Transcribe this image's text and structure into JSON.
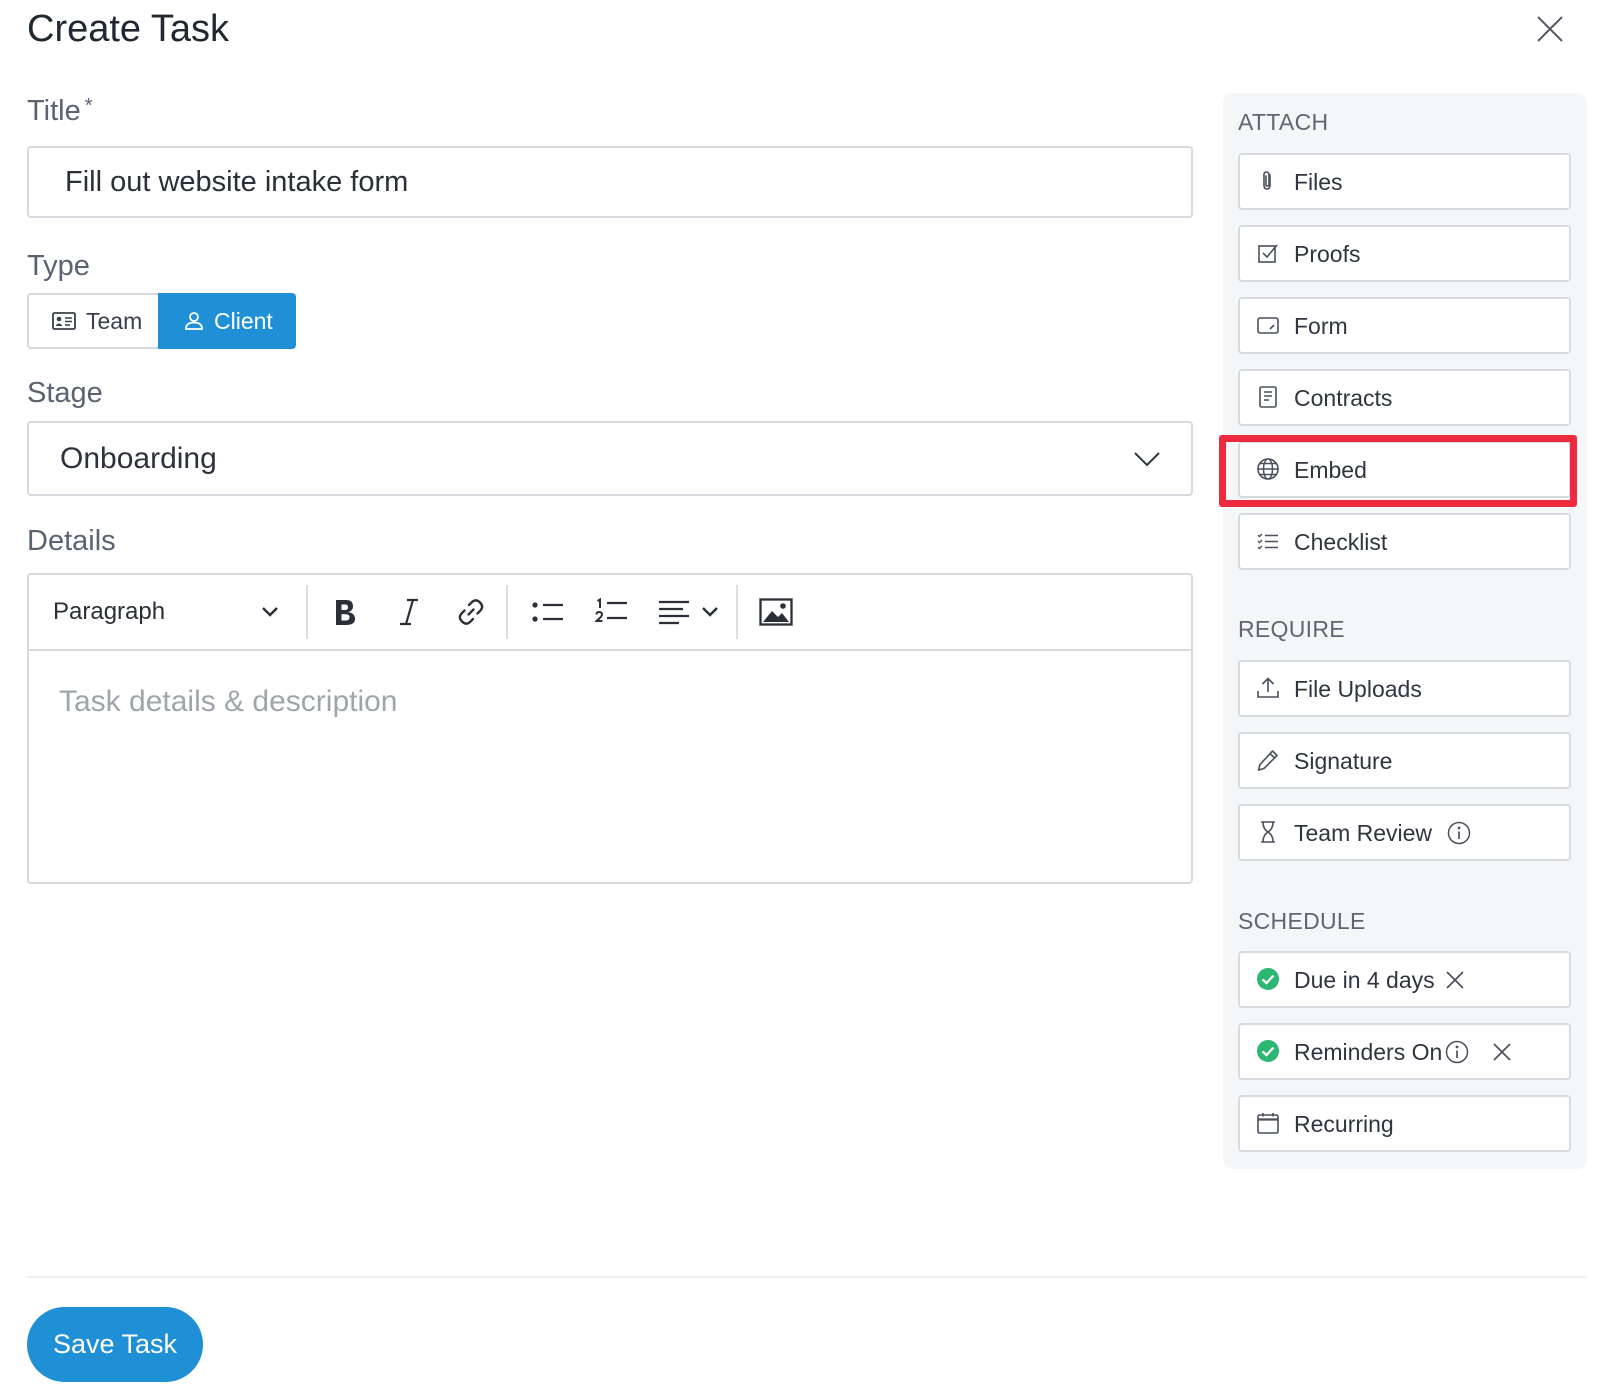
{
  "modal": {
    "title": "Create Task"
  },
  "title_field": {
    "label": "Title",
    "required_mark": "*",
    "value": "Fill out website intake form"
  },
  "type_field": {
    "label": "Type",
    "options": [
      {
        "label": "Team"
      },
      {
        "label": "Client"
      }
    ],
    "selected": "Client"
  },
  "stage_field": {
    "label": "Stage",
    "value": "Onboarding"
  },
  "details_field": {
    "label": "Details",
    "toolbar": {
      "format_select": "Paragraph"
    },
    "placeholder": "Task details & description"
  },
  "sidebar": {
    "attach": {
      "title": "ATTACH",
      "items": [
        {
          "label": "Files",
          "icon": "paperclip-icon"
        },
        {
          "label": "Proofs",
          "icon": "checkbox-icon"
        },
        {
          "label": "Form",
          "icon": "form-icon"
        },
        {
          "label": "Contracts",
          "icon": "document-icon"
        },
        {
          "label": "Embed",
          "icon": "globe-icon"
        },
        {
          "label": "Checklist",
          "icon": "checklist-icon"
        }
      ]
    },
    "require": {
      "title": "REQUIRE",
      "items": [
        {
          "label": "File Uploads",
          "icon": "upload-icon"
        },
        {
          "label": "Signature",
          "icon": "pen-icon"
        },
        {
          "label": "Team Review",
          "icon": "hourglass-icon"
        }
      ]
    },
    "schedule": {
      "title": "SCHEDULE",
      "items": [
        {
          "label": "Due in 4 days",
          "icon": "check-circle-icon"
        },
        {
          "label": "Reminders On",
          "icon": "check-circle-icon"
        },
        {
          "label": "Recurring",
          "icon": "calendar-icon"
        }
      ]
    }
  },
  "footer": {
    "save_label": "Save Task"
  },
  "colors": {
    "primary": "#1f8fd6",
    "highlight": "#ee2a3f",
    "success": "#2bb673"
  }
}
